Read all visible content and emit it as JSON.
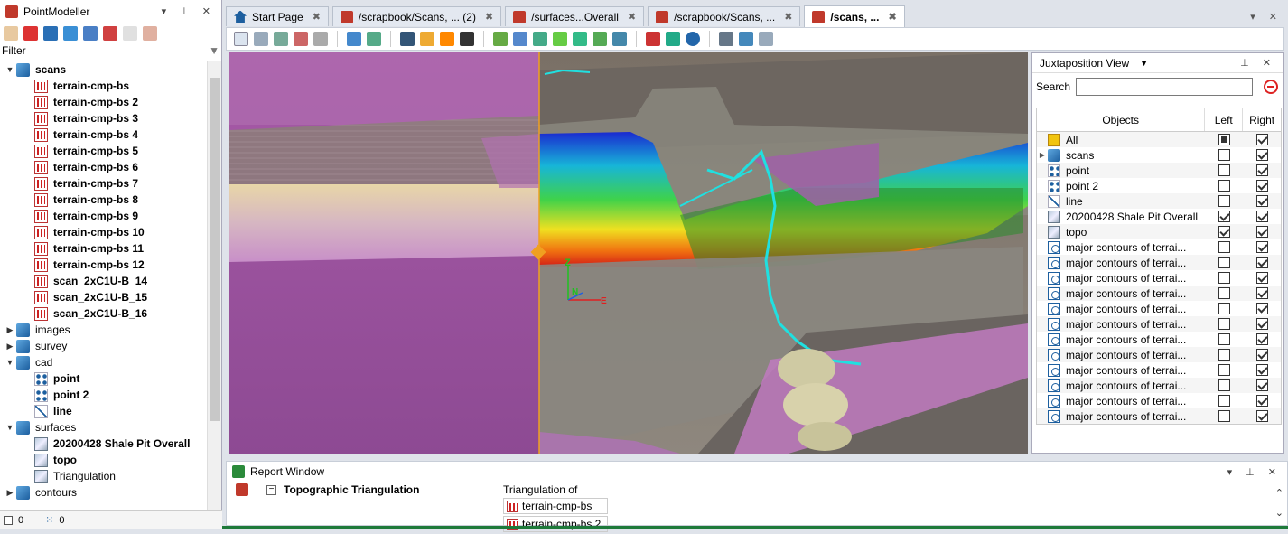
{
  "left_panel": {
    "title": "PointModeller",
    "filter_label": "Filter",
    "status": {
      "left_count": "0",
      "right_count": "0"
    },
    "tree": [
      {
        "label": "scans",
        "icon": "cube-icon",
        "expanded": true,
        "bold": true,
        "level": 0
      },
      {
        "label": "terrain-cmp-bs",
        "icon": "scan-icon",
        "level": 1,
        "bold": true
      },
      {
        "label": "terrain-cmp-bs 2",
        "icon": "scan-icon",
        "level": 1,
        "bold": true
      },
      {
        "label": "terrain-cmp-bs 3",
        "icon": "scan-icon",
        "level": 1,
        "bold": true
      },
      {
        "label": "terrain-cmp-bs 4",
        "icon": "scan-icon",
        "level": 1,
        "bold": true
      },
      {
        "label": "terrain-cmp-bs 5",
        "icon": "scan-icon",
        "level": 1,
        "bold": true
      },
      {
        "label": "terrain-cmp-bs 6",
        "icon": "scan-icon",
        "level": 1,
        "bold": true
      },
      {
        "label": "terrain-cmp-bs 7",
        "icon": "scan-icon",
        "level": 1,
        "bold": true
      },
      {
        "label": "terrain-cmp-bs 8",
        "icon": "scan-icon",
        "level": 1,
        "bold": true
      },
      {
        "label": "terrain-cmp-bs 9",
        "icon": "scan-icon",
        "level": 1,
        "bold": true
      },
      {
        "label": "terrain-cmp-bs 10",
        "icon": "scan-icon",
        "level": 1,
        "bold": true
      },
      {
        "label": "terrain-cmp-bs 11",
        "icon": "scan-icon",
        "level": 1,
        "bold": true
      },
      {
        "label": "terrain-cmp-bs 12",
        "icon": "scan-icon",
        "level": 1,
        "bold": true
      },
      {
        "label": "scan_2xC1U-B_14",
        "icon": "scan-icon",
        "level": 1,
        "bold": true
      },
      {
        "label": "scan_2xC1U-B_15",
        "icon": "scan-icon",
        "level": 1,
        "bold": true
      },
      {
        "label": "scan_2xC1U-B_16",
        "icon": "scan-icon",
        "level": 1,
        "bold": true
      },
      {
        "label": "images",
        "icon": "cube-icon",
        "level": 0
      },
      {
        "label": "survey",
        "icon": "cube-icon",
        "level": 0
      },
      {
        "label": "cad",
        "icon": "cube-icon",
        "expanded": true,
        "level": 0
      },
      {
        "label": "point",
        "icon": "points-icon",
        "level": 1,
        "bold": true
      },
      {
        "label": "point 2",
        "icon": "points-icon",
        "level": 1,
        "bold": true
      },
      {
        "label": "line",
        "icon": "line-icon",
        "level": 1,
        "bold": true
      },
      {
        "label": "surfaces",
        "icon": "cube-icon",
        "expanded": true,
        "level": 0
      },
      {
        "label": "20200428 Shale Pit Overall",
        "icon": "surface-icon",
        "level": 1,
        "bold": true
      },
      {
        "label": "topo",
        "icon": "surface-icon",
        "level": 1,
        "bold": true
      },
      {
        "label": "Triangulation",
        "icon": "surface-icon",
        "level": 1
      },
      {
        "label": "contours",
        "icon": "cube-icon",
        "collapsed": true,
        "level": 0
      }
    ]
  },
  "tabs": [
    {
      "label": "Start Page",
      "icon": "home-icon",
      "active": false
    },
    {
      "label": "/scrapbook/Scans, ... (2)",
      "icon": "pm-icon",
      "active": false
    },
    {
      "label": "/surfaces...Overall",
      "icon": "pm-icon",
      "active": false
    },
    {
      "label": "/scrapbook/Scans, ...",
      "icon": "pm-icon",
      "active": false
    },
    {
      "label": "/scans, ...",
      "icon": "pm-icon",
      "active": true
    }
  ],
  "juxtaposition": {
    "title": "Juxtaposition View",
    "search_label": "Search",
    "search_value": "",
    "headers": {
      "objects": "Objects",
      "left": "Left",
      "right": "Right"
    },
    "rows": [
      {
        "label": "All",
        "icon": "folder-icon",
        "left": "partial",
        "right": true
      },
      {
        "label": "scans",
        "icon": "cube-icon",
        "expand": true,
        "left": false,
        "right": true
      },
      {
        "label": "point",
        "icon": "points-icon",
        "left": false,
        "right": true
      },
      {
        "label": "point 2",
        "icon": "points-icon",
        "left": false,
        "right": true
      },
      {
        "label": "line",
        "icon": "line-icon",
        "left": false,
        "right": true
      },
      {
        "label": "20200428 Shale Pit Overall",
        "icon": "surface-icon",
        "left": true,
        "right": true
      },
      {
        "label": "topo",
        "icon": "surface-icon",
        "left": true,
        "right": true
      },
      {
        "label": "major contours of terrai...",
        "icon": "contour-icon",
        "left": false,
        "right": true
      },
      {
        "label": "major contours of terrai...",
        "icon": "contour-icon",
        "left": false,
        "right": true
      },
      {
        "label": "major contours of terrai...",
        "icon": "contour-icon",
        "left": false,
        "right": true
      },
      {
        "label": "major contours of terrai...",
        "icon": "contour-icon",
        "left": false,
        "right": true
      },
      {
        "label": "major contours of terrai...",
        "icon": "contour-icon",
        "left": false,
        "right": true
      },
      {
        "label": "major contours of terrai...",
        "icon": "contour-icon",
        "left": false,
        "right": true
      },
      {
        "label": "major contours of terrai...",
        "icon": "contour-icon",
        "left": false,
        "right": true
      },
      {
        "label": "major contours of terrai...",
        "icon": "contour-icon",
        "left": false,
        "right": true
      },
      {
        "label": "major contours of terrai...",
        "icon": "contour-icon",
        "left": false,
        "right": true
      },
      {
        "label": "major contours of terrai...",
        "icon": "contour-icon",
        "left": false,
        "right": true
      },
      {
        "label": "major contours of terrai...",
        "icon": "contour-icon",
        "left": false,
        "right": true
      },
      {
        "label": "major contours of terrai...",
        "icon": "contour-icon",
        "left": false,
        "right": true
      }
    ]
  },
  "report": {
    "title": "Report Window",
    "section": "Topographic Triangulation",
    "triangulation_label": "Triangulation of",
    "sources": [
      "terrain-cmp-bs",
      "terrain-cmp-bs 2"
    ]
  },
  "viewport": {
    "axis_z": "Z",
    "axis_n": "N",
    "axis_e": "E"
  },
  "colors": {
    "accent": "#1d5f9f",
    "brand_red": "#c0392b",
    "status_green": "#1e7a3a"
  }
}
